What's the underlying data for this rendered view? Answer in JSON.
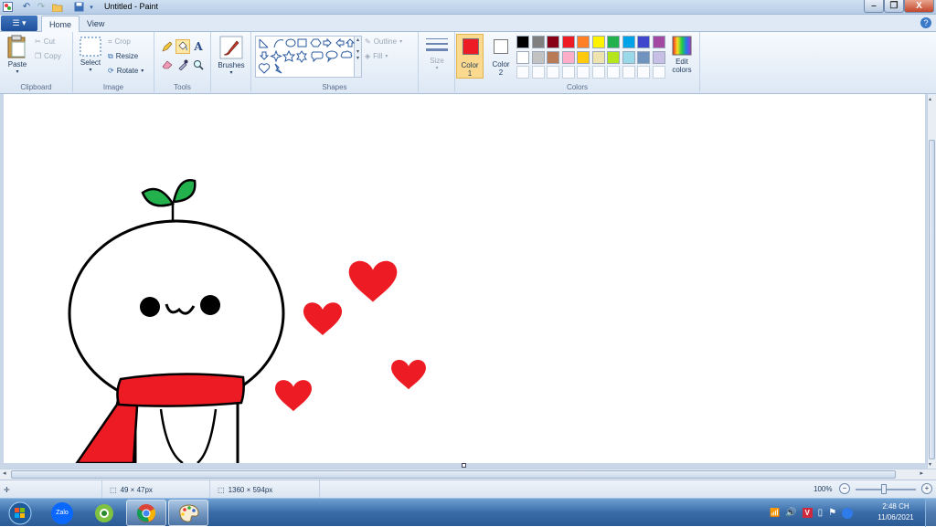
{
  "window": {
    "title": "Untitled - Paint",
    "controls": {
      "minimize": "–",
      "maximize": "❐",
      "close": "X"
    }
  },
  "tabs": {
    "menu_glyph": "☰ ▾",
    "home": "Home",
    "view": "View"
  },
  "help_glyph": "?",
  "ribbon": {
    "clipboard": {
      "label": "Clipboard",
      "paste": "Paste",
      "cut": "Cut",
      "copy": "Copy"
    },
    "image": {
      "label": "Image",
      "select": "Select",
      "crop": "Crop",
      "resize": "Resize",
      "rotate": "Rotate"
    },
    "tools": {
      "label": "Tools"
    },
    "brushes": {
      "label": "Brushes"
    },
    "shapes": {
      "label": "Shapes",
      "outline": "Outline",
      "fill": "Fill"
    },
    "size": {
      "label": "Size"
    },
    "colors": {
      "label": "Colors",
      "color1_label": "Color",
      "color1_num": "1",
      "color2_label": "Color",
      "color2_num": "2",
      "color1_value": "#ed1c24",
      "color2_value": "#ffffff",
      "edit_label": "Edit",
      "edit_label2": "colors",
      "palette_row1": [
        "#000000",
        "#7f7f7f",
        "#880015",
        "#ed1c24",
        "#ff7f27",
        "#fff200",
        "#22b14c",
        "#00a2e8",
        "#3f48cc",
        "#a349a4"
      ],
      "palette_row2": [
        "#ffffff",
        "#c3c3c3",
        "#b97a57",
        "#ffaec9",
        "#ffc90e",
        "#efe4b0",
        "#b5e61d",
        "#99d9ea",
        "#7092be",
        "#c8bfe7"
      ]
    }
  },
  "status": {
    "selection_size": "49 × 47px",
    "image_size": "1360 × 594px",
    "zoom": "100%"
  },
  "taskbar": {
    "apps": [
      "start-orb",
      "zalo",
      "coccoc",
      "chrome",
      "paint"
    ],
    "zalo_label": "Zalo",
    "clock_time": "2:48 CH",
    "clock_date": "11/06/2021"
  },
  "drawing": {
    "face_text": "•ω•",
    "heart_color": "#ed1c24",
    "leaf_color": "#22b14c",
    "scarf_color": "#ed1c24"
  }
}
